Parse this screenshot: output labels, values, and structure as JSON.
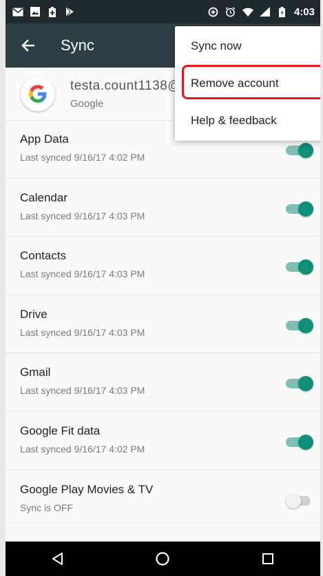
{
  "status_bar": {
    "time": "4:03",
    "left_icons": [
      "gmail-icon",
      "gallery-icon",
      "battery-saver-icon",
      "play-store-icon"
    ],
    "right_icons": [
      "data-saver-icon",
      "alarm-icon",
      "wifi-icon",
      "cell-signal-icon",
      "battery-icon"
    ]
  },
  "app_bar": {
    "title": "Sync",
    "back_icon": "arrow-left-icon"
  },
  "account": {
    "email": "testa.count1138@gmail.com",
    "provider": "Google"
  },
  "sync_items": [
    {
      "title": "App Data",
      "subtitle": "Last synced 9/16/17 4:02 PM",
      "enabled": true
    },
    {
      "title": "Calendar",
      "subtitle": "Last synced 9/16/17 4:03 PM",
      "enabled": true
    },
    {
      "title": "Contacts",
      "subtitle": "Last synced 9/16/17 4:03 PM",
      "enabled": true
    },
    {
      "title": "Drive",
      "subtitle": "Last synced 9/16/17 4:03 PM",
      "enabled": true
    },
    {
      "title": "Gmail",
      "subtitle": "Last synced 9/16/17 4:03 PM",
      "enabled": true
    },
    {
      "title": "Google Fit data",
      "subtitle": "Last synced 9/16/17 4:02 PM",
      "enabled": true
    },
    {
      "title": "Google Play Movies & TV",
      "subtitle": "Sync is OFF",
      "enabled": false
    }
  ],
  "menu": {
    "items": [
      {
        "label": "Sync now"
      },
      {
        "label": "Remove account"
      },
      {
        "label": "Help & feedback"
      }
    ],
    "highlight_color": "#e3141b"
  },
  "nav_bar": {
    "icons": [
      "back-triangle-icon",
      "home-circle-icon",
      "recents-square-icon"
    ]
  },
  "colors": {
    "status_bar": "#1f2a2e",
    "app_bar": "#2d3f45",
    "toggle_on": "#0f8e78",
    "toggle_track_on": "#80bfb4"
  }
}
